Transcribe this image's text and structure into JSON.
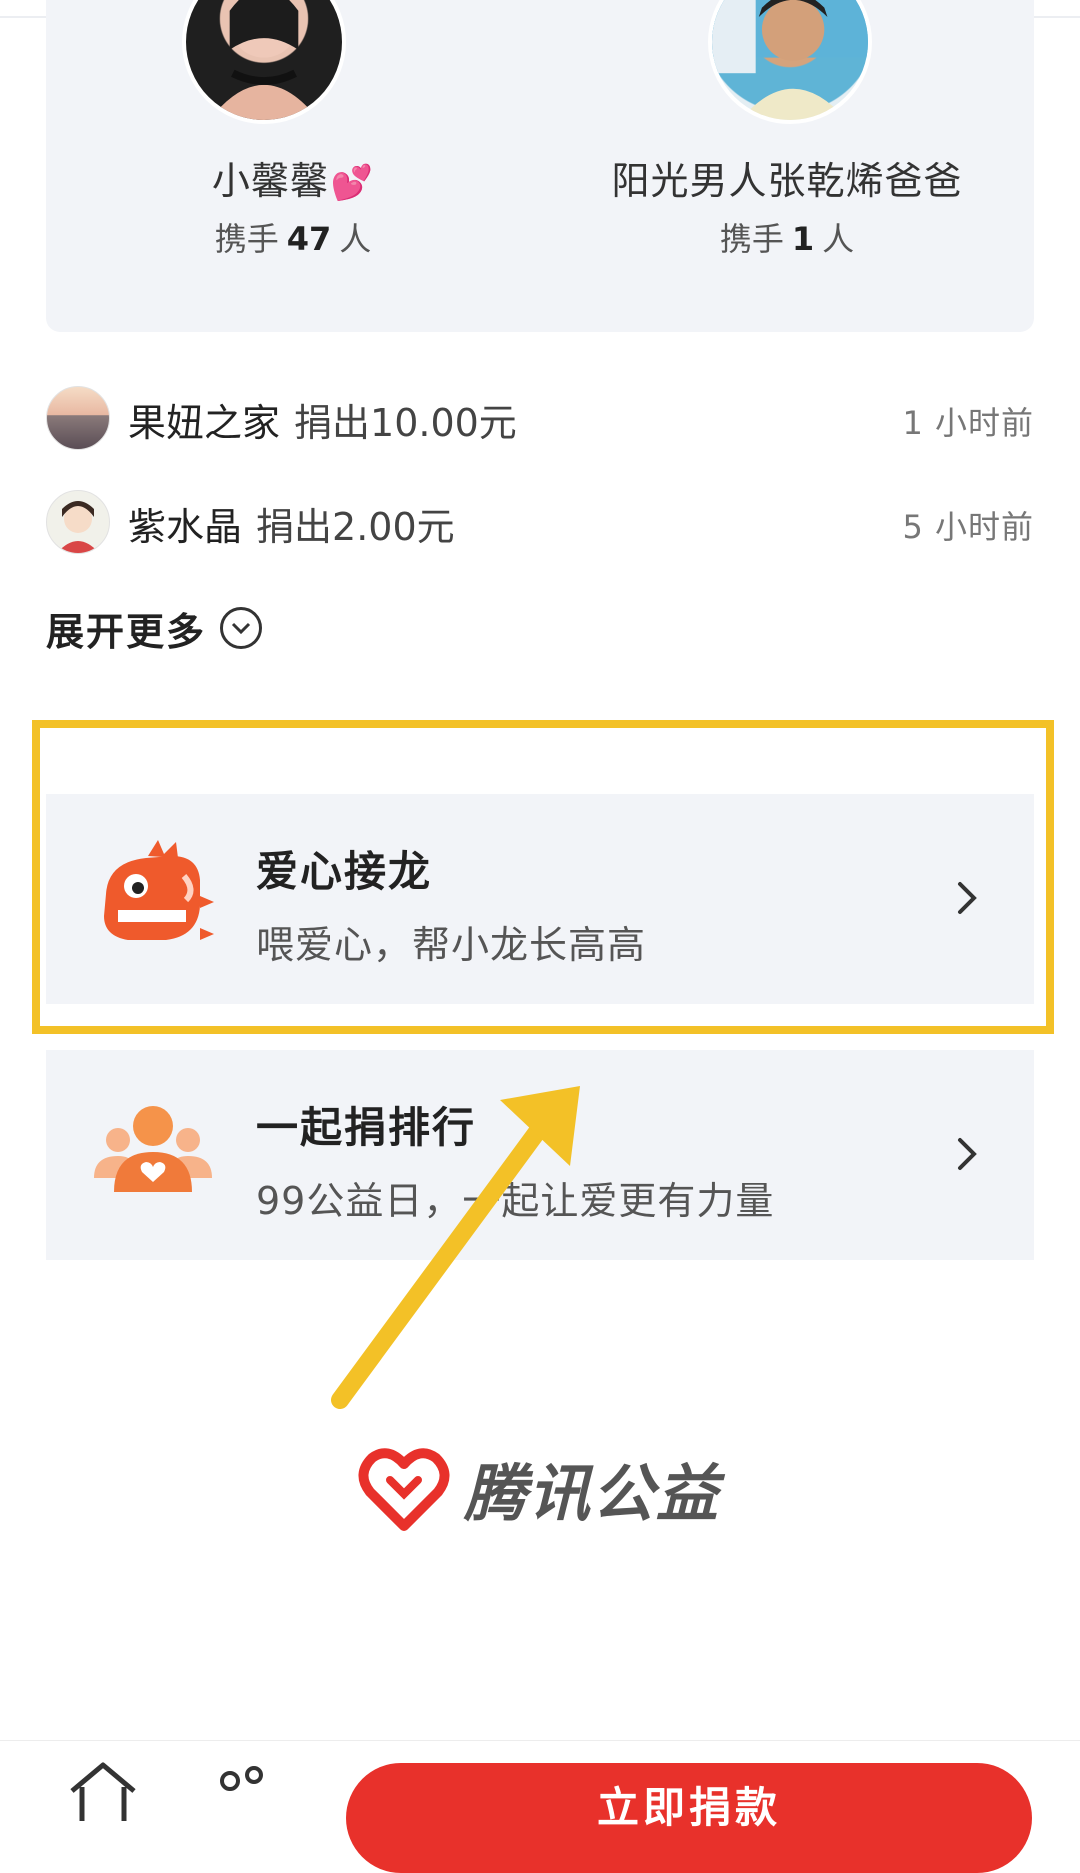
{
  "companions": [
    {
      "name": "小馨馨",
      "count_prefix": "携手",
      "count": "47",
      "count_suffix": "人",
      "emoji": "💕"
    },
    {
      "name": "阳光男人张乾烯爸爸",
      "count_prefix": "携手",
      "count": "1",
      "count_suffix": "人"
    }
  ],
  "donations": [
    {
      "name": "果妞之家",
      "amount": "捐出10.00元",
      "time": "1 小时前"
    },
    {
      "name": "紫水晶",
      "amount": "捐出2.00元",
      "time": "5 小时前"
    }
  ],
  "expand_more_label": "展开更多",
  "features": {
    "love_chain": {
      "title": "爱心接龙",
      "subtitle": "喂爱心，帮小龙长高高"
    },
    "rank": {
      "title": "一起捐排行",
      "subtitle": "99公益日，一起让爱更有力量"
    }
  },
  "logo_text": "腾讯公益",
  "bottom_bar": {
    "donate_label": "立即捐款"
  },
  "colors": {
    "accent_red": "#e8312b",
    "highlight_yellow": "#f3c127",
    "card_bg": "#f2f4f8",
    "dragon_orange": "#ef5a2c",
    "rank_orange": "#f5934a"
  },
  "icons": [
    "dragon-icon",
    "group-rank-icon",
    "chevron-right-icon",
    "chevron-down-icon",
    "tencent-charity-heart-icon",
    "home-icon",
    "people-icon"
  ]
}
